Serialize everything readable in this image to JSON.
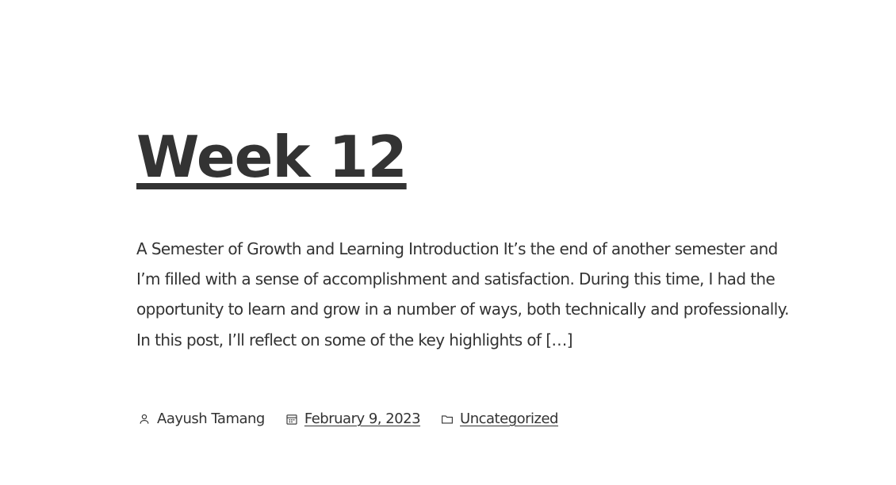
{
  "post": {
    "title": "Week 12",
    "excerpt": "A Semester of Growth and Learning Introduction It’s the end of another semester and I’m filled with a sense of accomplishment and satisfaction. During this time, I had the opportunity to learn and grow in a number of ways, both technically and professionally. In this post, I’ll reflect on some of the key highlights of […]",
    "meta": {
      "author": "Aayush Tamang",
      "author_icon": "person-icon",
      "date": "February 9, 2023",
      "date_icon": "calendar-icon",
      "category": "Uncategorized",
      "category_icon": "folder-icon"
    }
  },
  "colors": {
    "text": "#333333",
    "background": "#ffffff"
  }
}
